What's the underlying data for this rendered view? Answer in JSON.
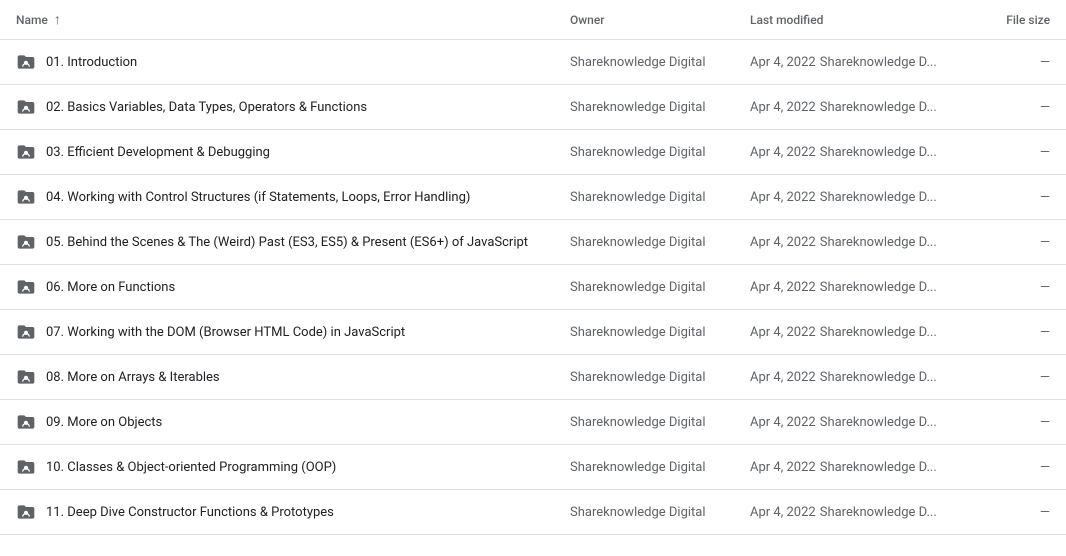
{
  "header": {
    "name_label": "Name",
    "owner_label": "Owner",
    "modified_label": "Last modified",
    "size_label": "File size"
  },
  "rows": [
    {
      "name": "01. Introduction",
      "owner": "Shareknowledge Digital",
      "modified_date": "Apr 4, 2022",
      "modified_by": "Shareknowledge D...",
      "size": "—"
    },
    {
      "name": "02. Basics Variables, Data Types, Operators & Functions",
      "owner": "Shareknowledge Digital",
      "modified_date": "Apr 4, 2022",
      "modified_by": "Shareknowledge D...",
      "size": "—"
    },
    {
      "name": "03. Efficient Development & Debugging",
      "owner": "Shareknowledge Digital",
      "modified_date": "Apr 4, 2022",
      "modified_by": "Shareknowledge D...",
      "size": "—"
    },
    {
      "name": "04. Working with Control Structures (if Statements, Loops, Error Handling)",
      "owner": "Shareknowledge Digital",
      "modified_date": "Apr 4, 2022",
      "modified_by": "Shareknowledge D...",
      "size": "—"
    },
    {
      "name": "05. Behind the Scenes & The (Weird) Past (ES3, ES5) & Present (ES6+) of JavaScript",
      "owner": "Shareknowledge Digital",
      "modified_date": "Apr 4, 2022",
      "modified_by": "Shareknowledge D...",
      "size": "—"
    },
    {
      "name": "06. More on Functions",
      "owner": "Shareknowledge Digital",
      "modified_date": "Apr 4, 2022",
      "modified_by": "Shareknowledge D...",
      "size": "—"
    },
    {
      "name": "07. Working with the DOM (Browser HTML Code) in JavaScript",
      "owner": "Shareknowledge Digital",
      "modified_date": "Apr 4, 2022",
      "modified_by": "Shareknowledge D...",
      "size": "—"
    },
    {
      "name": "08. More on Arrays & Iterables",
      "owner": "Shareknowledge Digital",
      "modified_date": "Apr 4, 2022",
      "modified_by": "Shareknowledge D...",
      "size": "—"
    },
    {
      "name": "09. More on Objects",
      "owner": "Shareknowledge Digital",
      "modified_date": "Apr 4, 2022",
      "modified_by": "Shareknowledge D...",
      "size": "—"
    },
    {
      "name": "10. Classes & Object-oriented Programming (OOP)",
      "owner": "Shareknowledge Digital",
      "modified_date": "Apr 4, 2022",
      "modified_by": "Shareknowledge D...",
      "size": "—"
    },
    {
      "name": "11. Deep Dive Constructor Functions & Prototypes",
      "owner": "Shareknowledge Digital",
      "modified_date": "Apr 4, 2022",
      "modified_by": "Shareknowledge D...",
      "size": "—"
    }
  ]
}
